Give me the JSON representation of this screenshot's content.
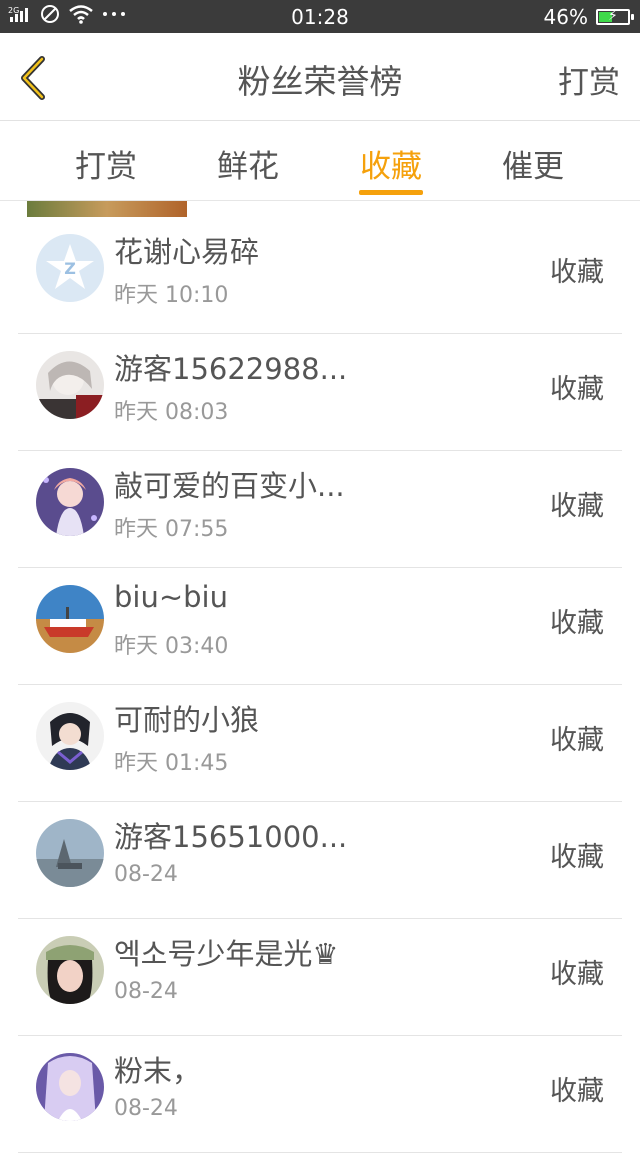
{
  "status_bar": {
    "network": "2G",
    "time": "01:28",
    "battery_percent": "46%",
    "battery_level": 0.46
  },
  "header": {
    "title": "粉丝荣誉榜",
    "right_action": "打赏",
    "back_icon": "chevron-left-icon"
  },
  "colors": {
    "accent": "#f5a10c",
    "status_bar_bg": "#3b3b3b",
    "text": "#555555",
    "subtext": "#999999"
  },
  "tabs": [
    {
      "label": "打赏",
      "active": false
    },
    {
      "label": "鲜花",
      "active": false
    },
    {
      "label": "收藏",
      "active": true
    },
    {
      "label": "催更",
      "active": false
    }
  ],
  "fans": [
    {
      "name": "花谢心易碎",
      "time": "昨天 10:10",
      "action": "收藏"
    },
    {
      "name": "游客15622988...",
      "time": "昨天 08:03",
      "action": "收藏"
    },
    {
      "name": "敲可爱的百变小...",
      "time": "昨天 07:55",
      "action": "收藏"
    },
    {
      "name": "biu~biu",
      "time": "昨天 03:40",
      "action": "收藏"
    },
    {
      "name": "可耐的小狼",
      "time": "昨天 01:45",
      "action": "收藏"
    },
    {
      "name": "游客15651000...",
      "time": "08-24",
      "action": "收藏"
    },
    {
      "name": "엑소号少年是光♛",
      "time": "08-24",
      "action": "收藏"
    },
    {
      "name": "粉末，",
      "time": "08-24",
      "action": "收藏"
    }
  ]
}
